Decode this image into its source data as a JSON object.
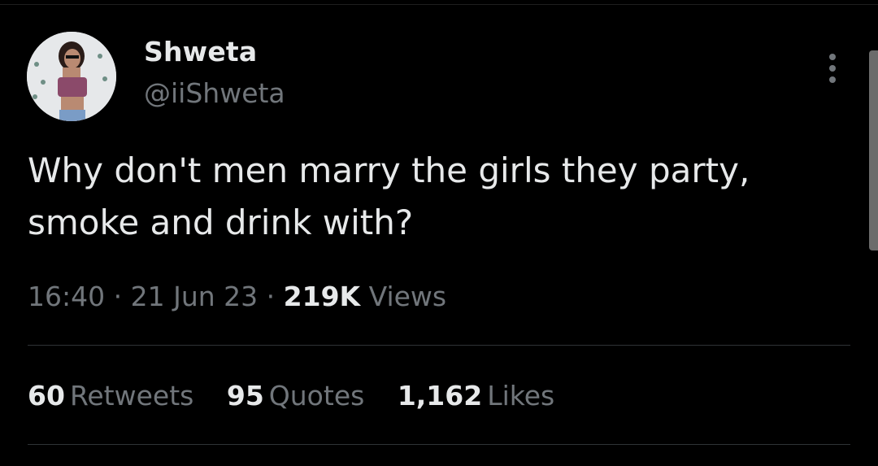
{
  "tweet": {
    "author": {
      "name": "Shweta",
      "handle": "@iiShweta"
    },
    "text": "Why don't men marry the girls they party,\nsmoke and drink with?",
    "time": "16:40",
    "separator": "·",
    "date": "21 Jun 23",
    "views_count": "219K",
    "views_label": "Views",
    "stats": {
      "retweets": {
        "count": "60",
        "label": "Retweets"
      },
      "quotes": {
        "count": "95",
        "label": "Quotes"
      },
      "likes": {
        "count": "1,162",
        "label": "Likes"
      }
    }
  },
  "colors": {
    "background": "#000000",
    "primary_text": "#e7e9ea",
    "secondary_text": "#71767b",
    "divider": "#2f3336"
  },
  "icons": {
    "more": "more-horizontal-icon"
  }
}
